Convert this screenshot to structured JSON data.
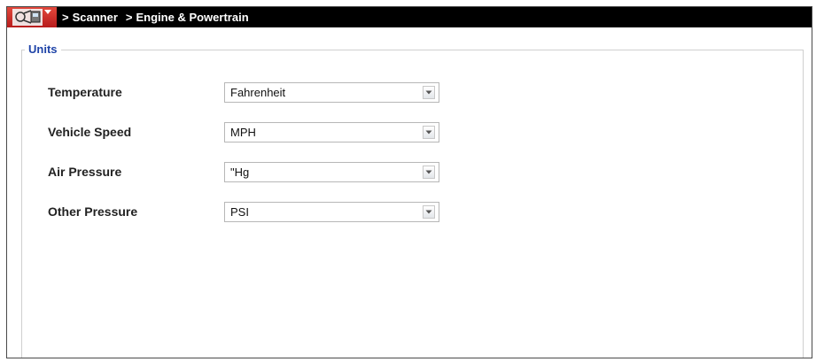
{
  "titlebar": {
    "home_icon": "scanner-home-icon",
    "breadcrumbs": [
      {
        "separator": ">",
        "label": "Scanner"
      },
      {
        "separator": ">",
        "label": "Engine & Powertrain"
      }
    ]
  },
  "units": {
    "legend": "Units",
    "settings": [
      {
        "label": "Temperature",
        "value": "Fahrenheit"
      },
      {
        "label": "Vehicle Speed",
        "value": "MPH"
      },
      {
        "label": "Air Pressure",
        "value": "\"Hg"
      },
      {
        "label": "Other Pressure",
        "value": "PSI"
      }
    ]
  },
  "colors": {
    "titlebar_bg": "#000000",
    "home_button_red": "#c62828",
    "legend_blue": "#1f44a8"
  }
}
